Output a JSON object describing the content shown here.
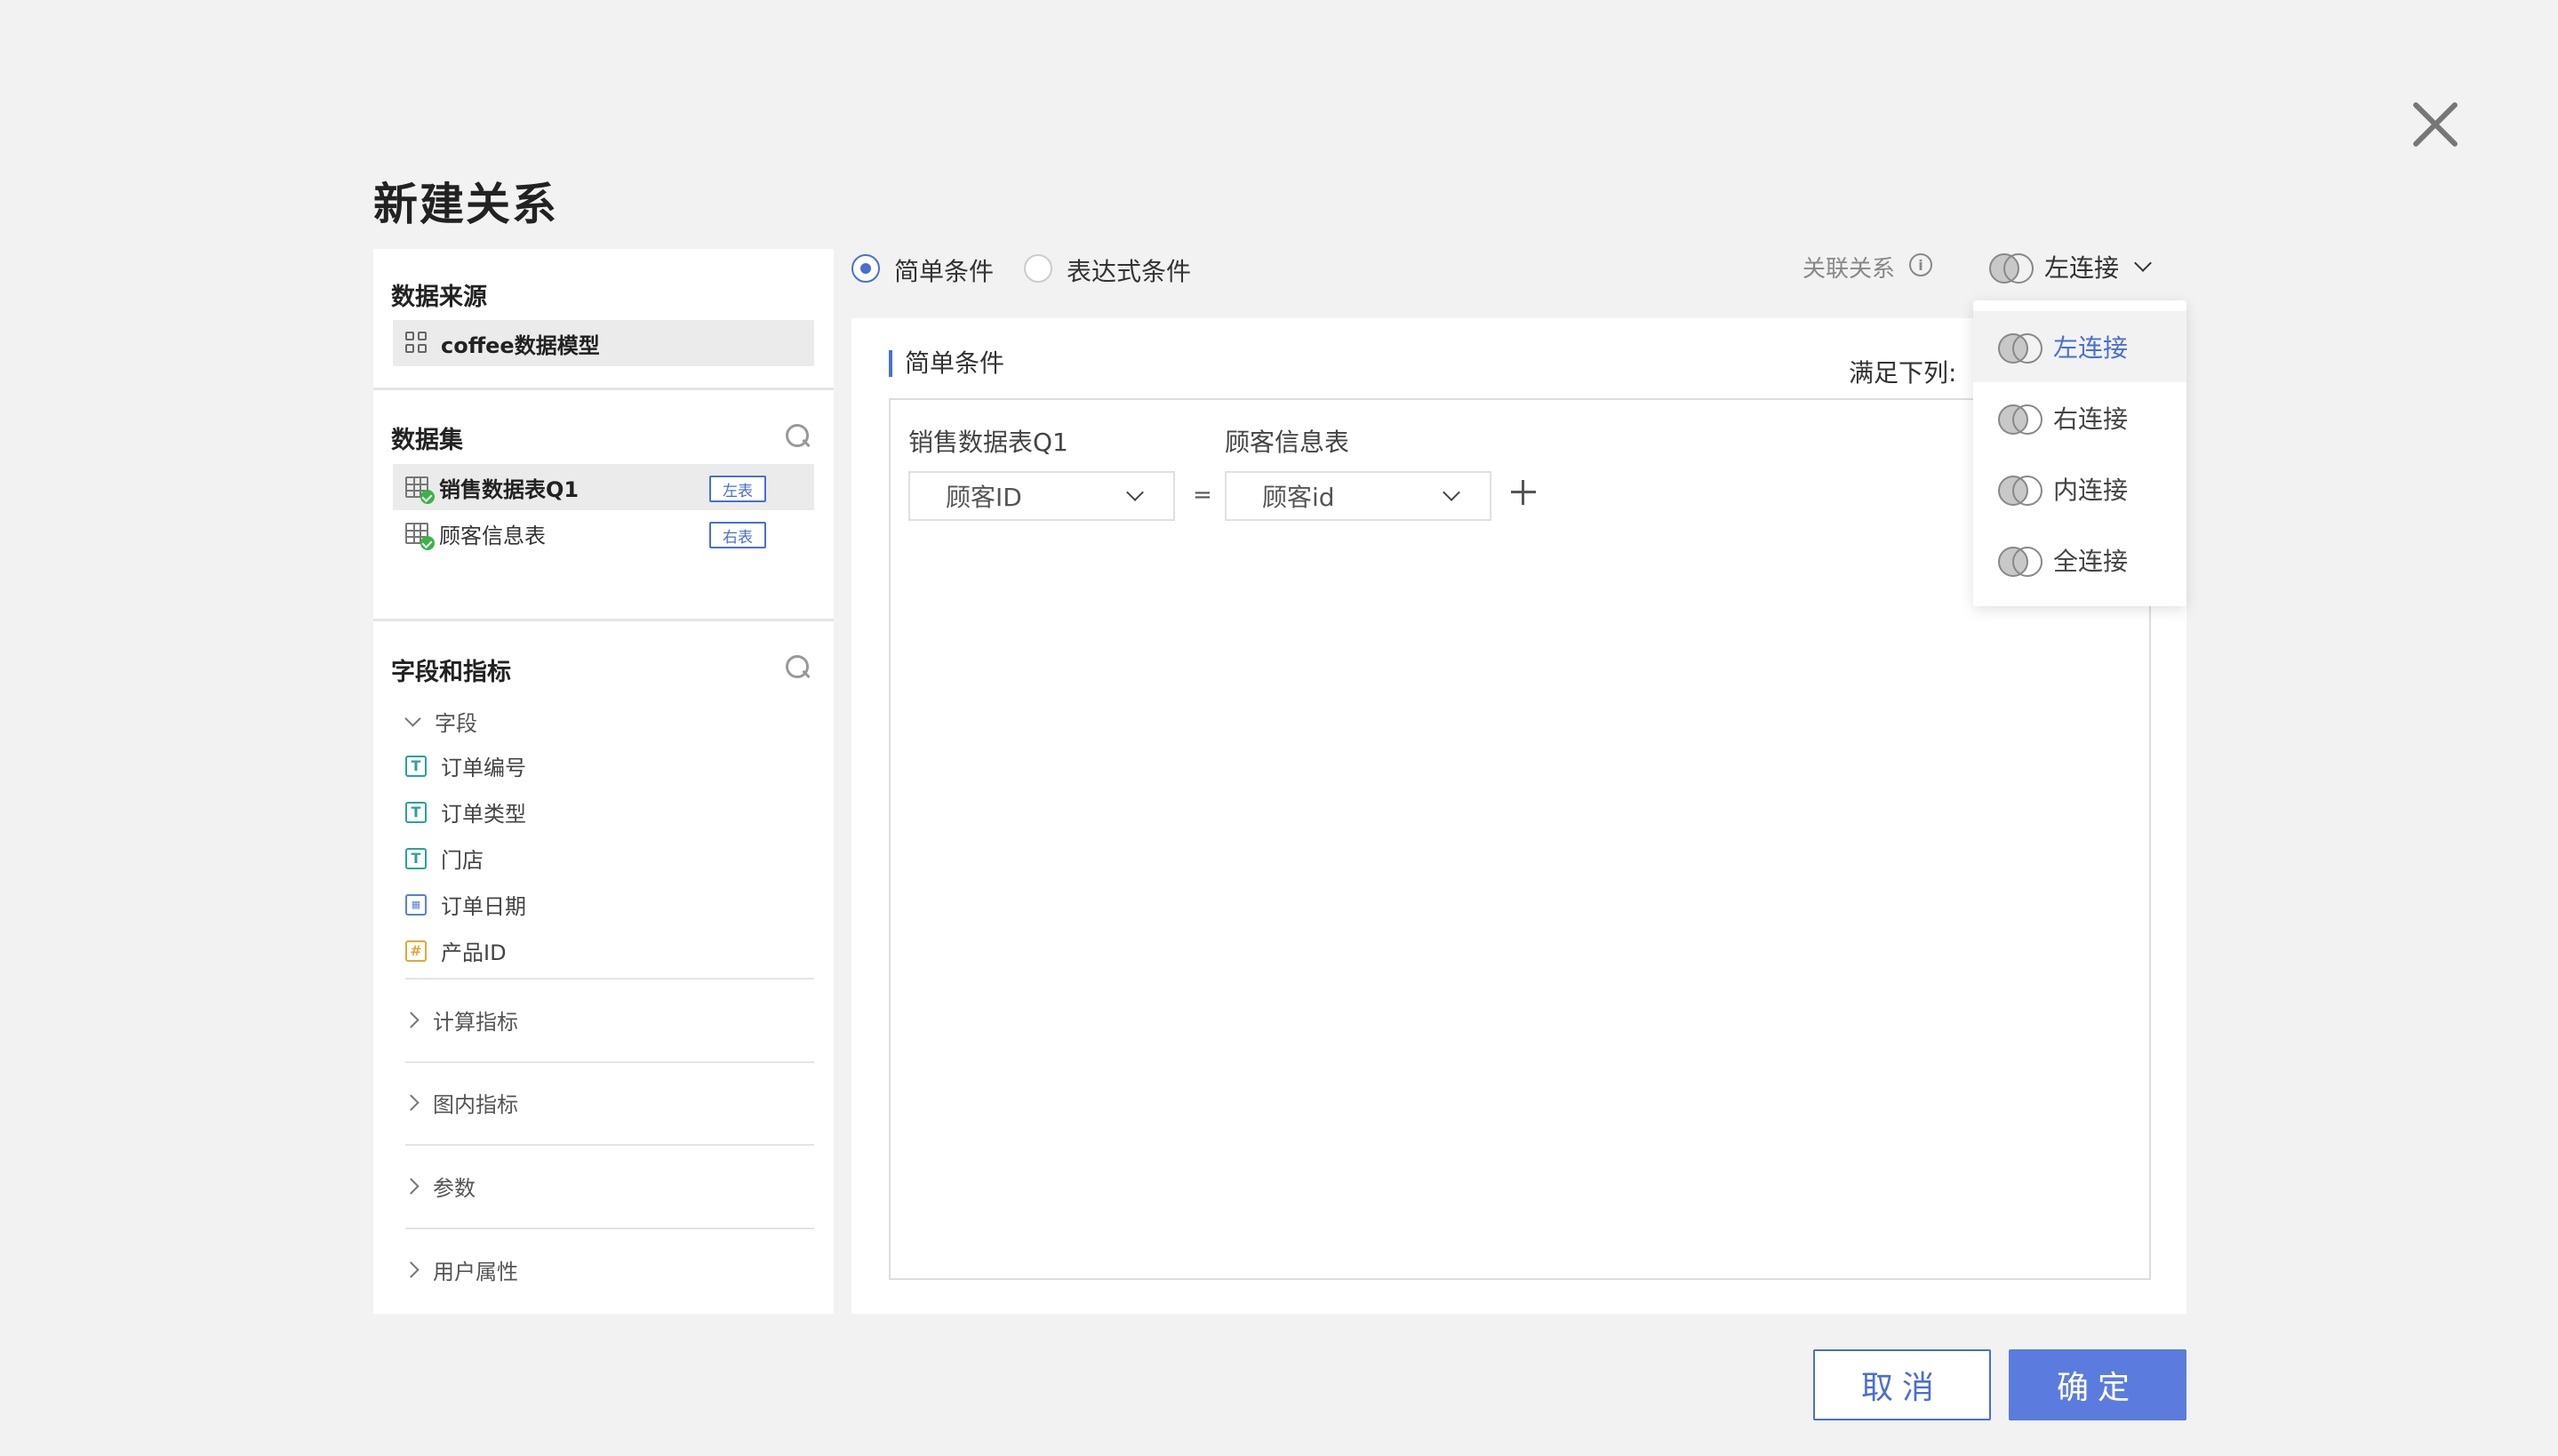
{
  "dialog": {
    "title": "新建关系"
  },
  "left_panel": {
    "data_source": {
      "title": "数据来源",
      "model_name": "coffee数据模型"
    },
    "dataset": {
      "title": "数据集",
      "items": [
        {
          "name": "销售数据表Q1",
          "tag": "左表"
        },
        {
          "name": "顾客信息表",
          "tag": "右表"
        }
      ]
    },
    "fields": {
      "title": "字段和指标",
      "group_label": "字段",
      "items": [
        {
          "name": "订单编号",
          "type": "text",
          "icon_glyph": "T"
        },
        {
          "name": "订单类型",
          "type": "text",
          "icon_glyph": "T"
        },
        {
          "name": "门店",
          "type": "text",
          "icon_glyph": "T"
        },
        {
          "name": "订单日期",
          "type": "date",
          "icon_glyph": "▦"
        },
        {
          "name": "产品ID",
          "type": "number",
          "icon_glyph": "#"
        }
      ],
      "collapsed_groups": [
        "计算指标",
        "图内指标",
        "参数",
        "用户属性"
      ]
    }
  },
  "condition_mode": {
    "simple": "简单条件",
    "expression": "表达式条件"
  },
  "relation": {
    "label": "关联关系",
    "selected": "左连接"
  },
  "join_options": [
    "左连接",
    "右连接",
    "内连接",
    "全连接"
  ],
  "condition_panel": {
    "title": "简单条件",
    "satisfy_label": "满足下列:",
    "left_table": "销售数据表Q1",
    "right_table": "顾客信息表",
    "left_field": "顾客ID",
    "operator": "=",
    "right_field": "顾客id"
  },
  "buttons": {
    "cancel": "取消",
    "ok": "确定"
  },
  "colors": {
    "accent": "#4a6fd1",
    "primary_button": "#5b7cde",
    "text_field_icon": "#2aa19a",
    "number_field_icon": "#e0a83a"
  }
}
